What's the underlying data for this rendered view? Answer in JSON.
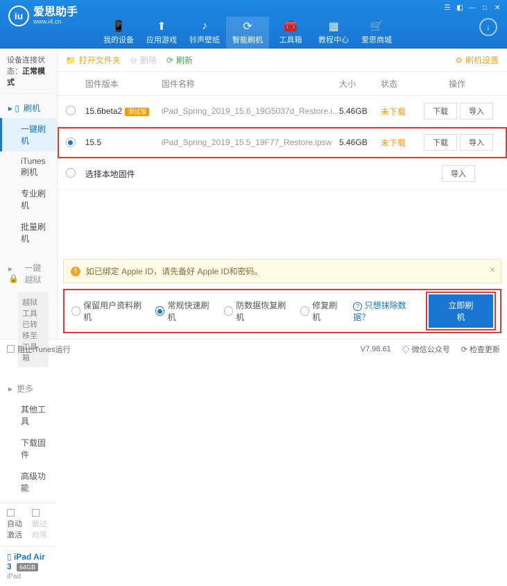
{
  "app": {
    "title": "爱思助手",
    "subtitle": "www.i4.cn",
    "logo_letter": "iu"
  },
  "nav": {
    "items": [
      {
        "label": "我的设备"
      },
      {
        "label": "应用游戏"
      },
      {
        "label": "铃声壁纸"
      },
      {
        "label": "智能刷机"
      },
      {
        "label": "工具箱"
      },
      {
        "label": "教程中心"
      },
      {
        "label": "爱思商城"
      }
    ],
    "active_index": 3
  },
  "connection": {
    "prefix": "设备连接状态：",
    "status": "正常模式"
  },
  "sidebar": {
    "sec1": {
      "head": "刷机",
      "items": [
        "一键刷机",
        "iTunes刷机",
        "专业刷机",
        "批量刷机"
      ],
      "active": 0
    },
    "sec2": {
      "head": "一键越狱",
      "note": "越狱工具已转移至工具箱"
    },
    "sec3": {
      "head": "更多",
      "items": [
        "其他工具",
        "下载固件",
        "高级功能"
      ]
    },
    "bottom": {
      "auto_activate": "自动激活",
      "skip_guide": "跳过向导"
    },
    "device": {
      "name": "iPad Air 3",
      "storage": "64GB",
      "type": "iPad"
    }
  },
  "toolbar": {
    "open_folder": "打开文件夹",
    "delete": "删除",
    "refresh": "刷新",
    "settings": "刷机设置"
  },
  "table": {
    "headers": {
      "version": "固件版本",
      "name": "固件名称",
      "size": "大小",
      "status": "状态",
      "ops": "操作"
    },
    "rows": [
      {
        "version": "15.6beta2",
        "badge": "测试版",
        "name": "iPad_Spring_2019_15.6_19G5037d_Restore.i...",
        "size": "5.46GB",
        "status": "未下载",
        "selected": false
      },
      {
        "version": "15.5",
        "badge": "",
        "name": "iPad_Spring_2019_15.5_19F77_Restore.ipsw",
        "size": "5.46GB",
        "status": "未下载",
        "selected": true
      }
    ],
    "local_row": "选择本地固件",
    "btn_download": "下载",
    "btn_import": "导入"
  },
  "warning": {
    "text": "如已绑定 Apple ID，请先备好 Apple ID和密码。"
  },
  "modes": {
    "opts": [
      "保留用户资料刷机",
      "常规快速刷机",
      "防数据恢复刷机",
      "修复刷机"
    ],
    "selected": 1,
    "link": "只想抹除数据？",
    "go": "立即刷机"
  },
  "footer": {
    "block_itunes": "阻止iTunes运行",
    "version": "V7.98.61",
    "wechat": "微信公众号",
    "check_update": "检查更新"
  }
}
